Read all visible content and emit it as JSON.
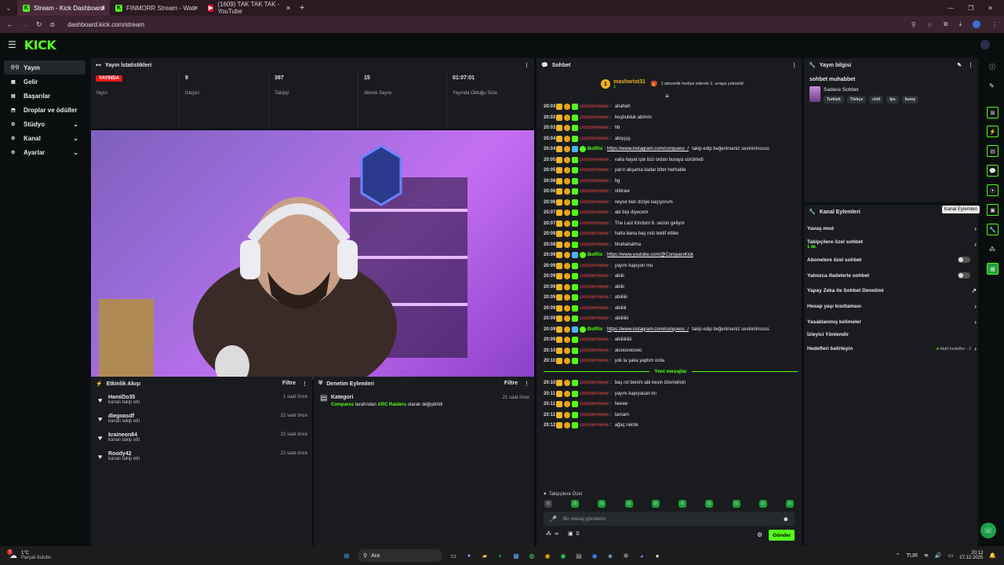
{
  "browser": {
    "tabs": [
      {
        "title": "Stream - Kick Dashboard",
        "active": true
      },
      {
        "title": "FINMORR Stream - Watch Livi",
        "active": false
      },
      {
        "title": "(1609) TAK TAK TAK - YouTube",
        "active": false
      }
    ],
    "url": "dashboard.kick.com/stream",
    "new_tab": "+"
  },
  "logo": "KICK",
  "sidebar": {
    "items": [
      {
        "label": "Yayın",
        "icon": "broadcast-icon",
        "active": true
      },
      {
        "label": "Gelir",
        "icon": "revenue-icon"
      },
      {
        "label": "Başarılar",
        "icon": "achievements-icon"
      },
      {
        "label": "Droplar ve ödüller",
        "icon": "drops-icon"
      },
      {
        "label": "Stüdyo",
        "icon": "studio-icon",
        "chevron": true
      },
      {
        "label": "Kanal",
        "icon": "channel-icon",
        "chevron": true
      },
      {
        "label": "Ayarlar",
        "icon": "settings-icon",
        "chevron": true
      }
    ]
  },
  "stats": {
    "title": "Yayın İstatistikleri",
    "status_badge": "YAYINDA",
    "status_label": "Yayın",
    "viewers": "9",
    "viewers_label": "İzleyici",
    "followers": "397",
    "followers_label": "Takipçi",
    "subs": "15",
    "subs_label": "Abone Sayısı",
    "uptime": "01:07:01",
    "uptime_label": "Yayında Olduğu Süre"
  },
  "activity": {
    "title": "Etkinlik Akışı",
    "filter": "Filtre",
    "items": [
      {
        "name": "HamiDo35",
        "sub": "kanalı takip etti",
        "time": "1 saat önce"
      },
      {
        "name": "diegoasdf",
        "sub": "kanalı takip etti",
        "time": "22 saat önce"
      },
      {
        "name": "kraineon84",
        "sub": "kanalı takip etti",
        "time": "22 saat önce"
      },
      {
        "name": "Roody42",
        "sub": "kanalı takip etti",
        "time": "22 saat önce"
      }
    ]
  },
  "moderation": {
    "title": "Denetim Eylemleri",
    "filter": "Filtre",
    "item_title": "Kategori",
    "actor": "Conquess",
    "middle": "tarafından",
    "target": "ARC Raiders",
    "end": "olarak değiştirildi",
    "time": "21 saat önce"
  },
  "chat": {
    "title": "Sohbet",
    "gift_user": "masharist31",
    "gift_count": "1",
    "gift_text": "1 abonelik hediye ederek 2. sıraya yükseldi",
    "new_messages": "Yeni mesajlar",
    "followers_only": "Takipçilere Özel",
    "input_placeholder": "Bir mesaj gönderin",
    "infinity": "∞",
    "count": "0",
    "send": "Gönder",
    "messages": [
      {
        "t": "20:03",
        "u": "Dutchermeow",
        "m": "ahahah"
      },
      {
        "t": "20:03",
        "u": "Dutchermeow",
        "m": "hoşbulduk abimm"
      },
      {
        "t": "20:03",
        "u": "Dutchermeow",
        "m": "hb"
      },
      {
        "t": "20:04",
        "u": "Dutchermeow",
        "m": "abişşşş"
      },
      {
        "t": "20:04",
        "u": "BotRix",
        "bot": true,
        "link": "https://www.instagram.com/conquess_/",
        "m": "takip edip beğenirseniz sevinirimssss"
      },
      {
        "t": "20:05",
        "u": "Dutchermeow",
        "m": "valla hayat işte bizi ordan buraya sürükledi"
      },
      {
        "t": "20:05",
        "u": "Dutchermeow",
        "m": "yarın akşama kadar biter herhalde"
      },
      {
        "t": "20:06",
        "u": "Dutchermeow",
        "m": "hg"
      },
      {
        "t": "20:06",
        "u": "Dutchermeow",
        "m": "shitraw"
      },
      {
        "t": "20:06",
        "u": "Dutchermeow",
        "m": "neyse ben diziye kaçıyorum"
      },
      {
        "t": "20:07",
        "u": "Dutchermeow",
        "m": "abi bişi diyecem"
      },
      {
        "t": "20:07",
        "u": "Dutchermeow",
        "m": "The Last Kindom 6. sezon geliyor"
      },
      {
        "t": "20:08",
        "u": "Dutchermeow",
        "m": "hatta bana baş rolü teklif ettiler"
      },
      {
        "t": "20:08",
        "u": "Dutchermeow",
        "m": "hhahahahha"
      },
      {
        "t": "20:09",
        "u": "BotRix",
        "bot": true,
        "link": "https://www.youtube.com/@ConquesKick",
        "m": ""
      },
      {
        "t": "20:09",
        "u": "Dutchermeow",
        "m": "yayını kapıyon mu"
      },
      {
        "t": "20:09",
        "u": "Dutchermeow",
        "m": "abiiii"
      },
      {
        "t": "20:09",
        "u": "Dutchermeow",
        "m": "abiiii"
      },
      {
        "t": "20:09",
        "u": "Dutchermeow",
        "m": "abiiiiiii"
      },
      {
        "t": "20:09",
        "u": "Dutchermeow",
        "m": "abiiiiii"
      },
      {
        "t": "20:09",
        "u": "Dutchermeow",
        "m": "abiiiiiiii"
      },
      {
        "t": "20:09",
        "u": "BotRix",
        "bot": true,
        "link": "https://www.instagram.com/conquess_/",
        "m": "takip edip beğenirseniz sevinirimssss"
      },
      {
        "t": "20:09",
        "u": "Dutchermeow",
        "m": "abiiiiiiiiiii"
      },
      {
        "t": "20:10",
        "u": "Dutchermeow",
        "m": "alooooooooo"
      },
      {
        "t": "20:10",
        "u": "Dutchermeow",
        "m": "yok la şaka yaptım orda"
      },
      {
        "t": "20:10",
        "u": "Dutchermeow",
        "m": "baş rol benim abi kesin izlemelisin"
      },
      {
        "t": "20:11",
        "u": "Dutchermeow",
        "m": "yayını kapıyacan mı"
      },
      {
        "t": "20:11",
        "u": "Dutchermeow",
        "m": "heeee"
      },
      {
        "t": "20:11",
        "u": "Dutchermeow",
        "m": "tamam"
      },
      {
        "t": "20:12",
        "u": "Dutchermeow",
        "m": "ağaç nerde"
      }
    ]
  },
  "stream_info": {
    "title": "Yayın bilgisi",
    "stream_title": "sohbet muhabbet",
    "category": "Sadece Sohbet",
    "tags": [
      "Turkish",
      "Türkçe",
      "chill",
      "fps",
      "funny"
    ]
  },
  "channel_actions": {
    "title": "Kanal Eylemleri",
    "tooltip": "Kanal Eylemleri",
    "items": [
      {
        "label": "Yavaş mod",
        "right": "›"
      },
      {
        "label": "Takipçilere özel sohbet",
        "sub": "1 dk.",
        "right": "›"
      },
      {
        "label": "Abonelere özel sohbet",
        "toggle": true
      },
      {
        "label": "Yalnızca ifadelerle sohbet",
        "toggle": true
      },
      {
        "label": "Yapay Zeka ile Sohbet Denetimi",
        "right": "↗"
      },
      {
        "label": "Hesap yaşı kısıtlaması",
        "right": "›"
      },
      {
        "label": "Yasaklanmış kelimeler",
        "right": "›"
      },
      {
        "label": "İzleyici Yönlendir",
        "right": ""
      },
      {
        "label": "Hedefleri belirleyin",
        "status": "Aktif hedefler - 2",
        "right": "›"
      }
    ]
  },
  "taskbar": {
    "weather_temp": "1°C",
    "weather_desc": "Parçalı bulutlu",
    "weather_badge": "7",
    "search": "Ara",
    "lang": "TUR",
    "time": "20:12",
    "date": "27.12.2025"
  },
  "colors": {
    "accent": "#53fc18",
    "panel": "#191b1f",
    "bg": "#0b0e0f",
    "live": "#e91916"
  }
}
